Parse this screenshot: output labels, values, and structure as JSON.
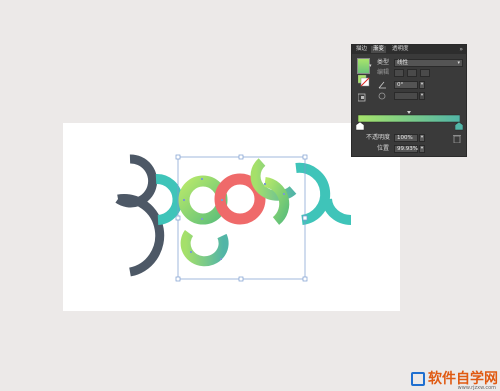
{
  "panel": {
    "tabs": [
      {
        "label": "描边"
      },
      {
        "label": "渐变"
      },
      {
        "label": "透明度"
      }
    ],
    "close_symbol": "»",
    "type_label": "类型",
    "type_value": "线性",
    "edit_label": "编辑",
    "angle_value": "0°",
    "opacity_label": "不透明度",
    "opacity_value": "100%",
    "location_label": "位置",
    "location_value": "99.93%",
    "stop_colors": [
      "#a6e36b",
      "#52b5a7"
    ],
    "icons": [
      "gradient-swatch-icon",
      "reverse-gradient-icon",
      "angle-icon",
      "aspect-ratio-icon",
      "delete-stop-icon"
    ]
  },
  "artwork": {
    "shape_colors": {
      "slate": "#4d5866",
      "teal": "#3fc4b9",
      "coral": "#ef6a6a",
      "lime": "#a5e06a",
      "green": "#6dc37b"
    }
  },
  "watermark": {
    "logo_letter": "ru",
    "text": "软件自学网",
    "url": "www.rjzxw.com"
  }
}
